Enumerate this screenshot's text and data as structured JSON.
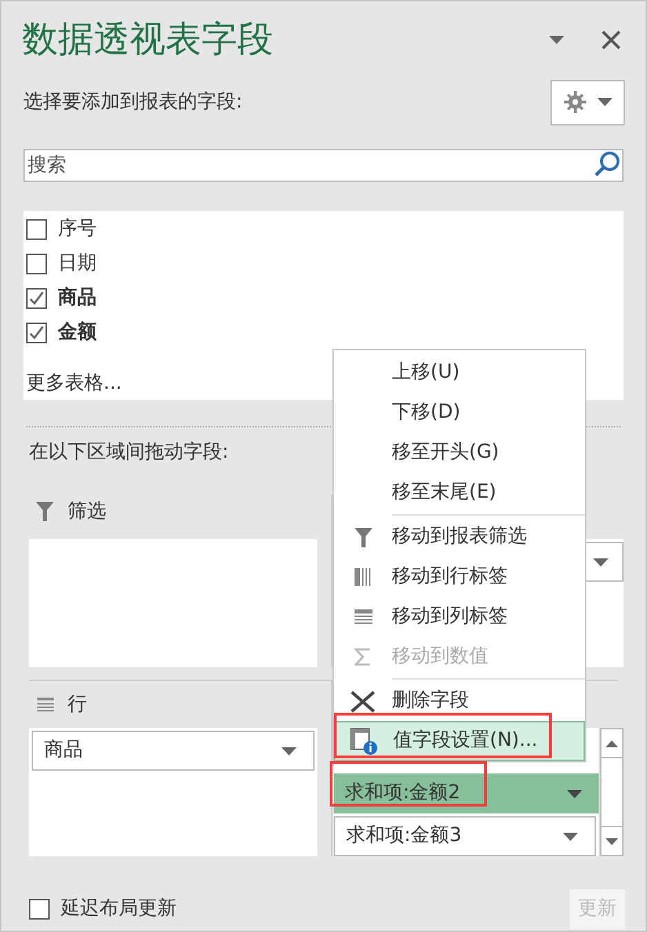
{
  "title": "数据透视表字段",
  "choose_label": "选择要添加到报表的字段:",
  "search": {
    "placeholder": "搜索"
  },
  "fields": [
    {
      "label": "序号",
      "checked": false
    },
    {
      "label": "日期",
      "checked": false
    },
    {
      "label": "商品",
      "checked": true
    },
    {
      "label": "金额",
      "checked": true
    }
  ],
  "more_tables": "更多表格...",
  "drag_label": "在以下区域间拖动字段:",
  "filter_area": {
    "label": "筛选"
  },
  "rows_area": {
    "label": "行",
    "items": [
      "商品"
    ]
  },
  "values_area": {
    "items": [
      {
        "label": "求和项:金额2",
        "selected": true
      },
      {
        "label": "求和项:金额3",
        "selected": false
      }
    ]
  },
  "context_menu": [
    {
      "kind": "item",
      "label": "上移(U)",
      "disabled": false,
      "selected": false
    },
    {
      "kind": "item",
      "label": "下移(D)",
      "disabled": false,
      "selected": false
    },
    {
      "kind": "item",
      "label": "移至开头(G)",
      "disabled": false,
      "selected": false
    },
    {
      "kind": "item",
      "label": "移至末尾(E)",
      "disabled": false,
      "selected": false
    },
    {
      "kind": "separator"
    },
    {
      "kind": "item",
      "label": "移动到报表筛选",
      "disabled": false,
      "selected": false
    },
    {
      "kind": "item",
      "label": "移动到行标签",
      "disabled": false,
      "selected": false
    },
    {
      "kind": "item",
      "label": "移动到列标签",
      "disabled": false,
      "selected": false
    },
    {
      "kind": "item",
      "label": "移动到数值",
      "disabled": true,
      "selected": false
    },
    {
      "kind": "separator"
    },
    {
      "kind": "item",
      "label": "删除字段",
      "disabled": false,
      "selected": false
    },
    {
      "kind": "item",
      "label": "值字段设置(N)...",
      "disabled": false,
      "selected": true
    }
  ],
  "defer_update": {
    "label": "延迟布局更新",
    "checked": false
  },
  "update_button": {
    "label": "更新",
    "disabled": true
  }
}
